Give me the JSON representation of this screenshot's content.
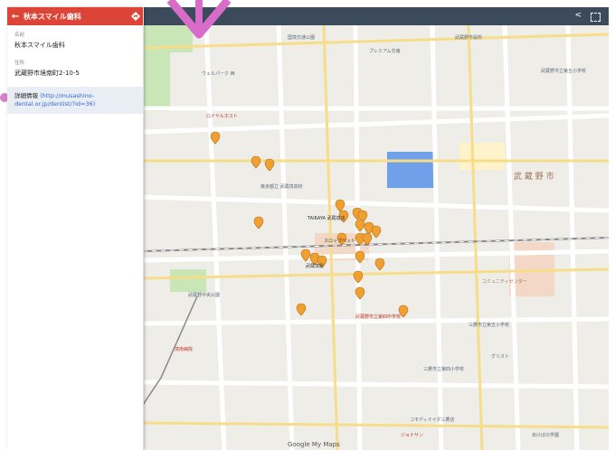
{
  "panel": {
    "title": "秋本スマイル歯科",
    "name_label": "名前",
    "name_value": "秋本スマイル歯科",
    "address_label": "住所",
    "address_value": "武蔵野市境南町2-10-5",
    "detail_label": "詳細情報",
    "detail_link": "(http://musashino-dental.or.jp/dentist/?id=36)"
  },
  "map": {
    "google_label": "Google My Maps",
    "pin_count": 27,
    "labels": [
      "国境交通公園",
      "プレミアム交番",
      "武蔵野市役所",
      "武蔵野市立第五小学校",
      "ウェルパーク 西",
      "ロイヤルホスト",
      "武蔵野市",
      "TAIRAYA 武蔵境店",
      "イトーヨーカドー 武蔵境店",
      "スロップベット",
      "武蔵境駅",
      "すきっち",
      "東京都立 武蔵境高校",
      "コミュニティセンター",
      "三鷹市立第五小学校",
      "武蔵野中央公園",
      "中央駅",
      "三鷹市立第四小学校",
      "コモディイイダ三鷹店",
      "ジョナサン",
      "境南病院",
      "武蔵野市立第四中学校",
      "グリスト",
      "あけぼの学園"
    ]
  }
}
